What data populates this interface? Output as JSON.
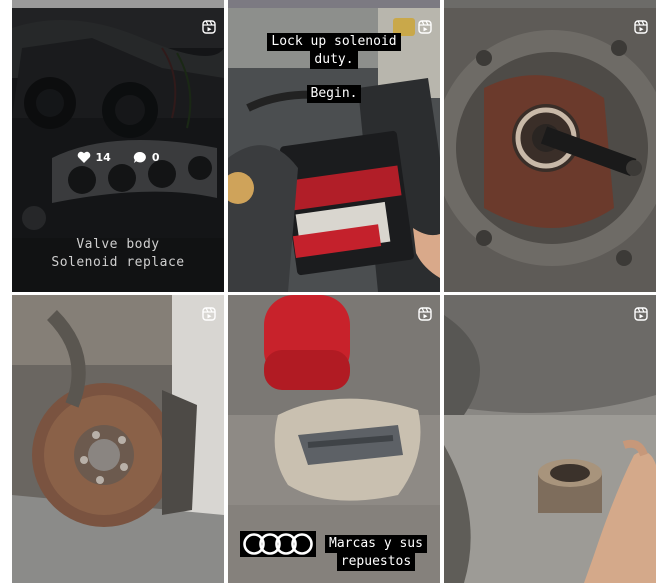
{
  "grid": {
    "tiles": [
      {
        "id": "valve-body",
        "type": "reel-icon",
        "likes": "14",
        "comments": "0",
        "caption_lines": [
          "Valve body",
          "Solenoid replace"
        ],
        "hovered": true
      },
      {
        "id": "lock-up",
        "type": "reel-icon",
        "caption_top": [
          "Lock up solenoid",
          "duty."
        ],
        "caption_mid": "Begin."
      },
      {
        "id": "clutch",
        "type": "reel-icon"
      },
      {
        "id": "brake-disc",
        "type": "reel-icon"
      },
      {
        "id": "brake-pads",
        "type": "reel-icon",
        "caption_lines": [
          "Marcas y sus",
          "repuestos"
        ]
      },
      {
        "id": "bearing",
        "type": "reel-icon"
      }
    ]
  }
}
